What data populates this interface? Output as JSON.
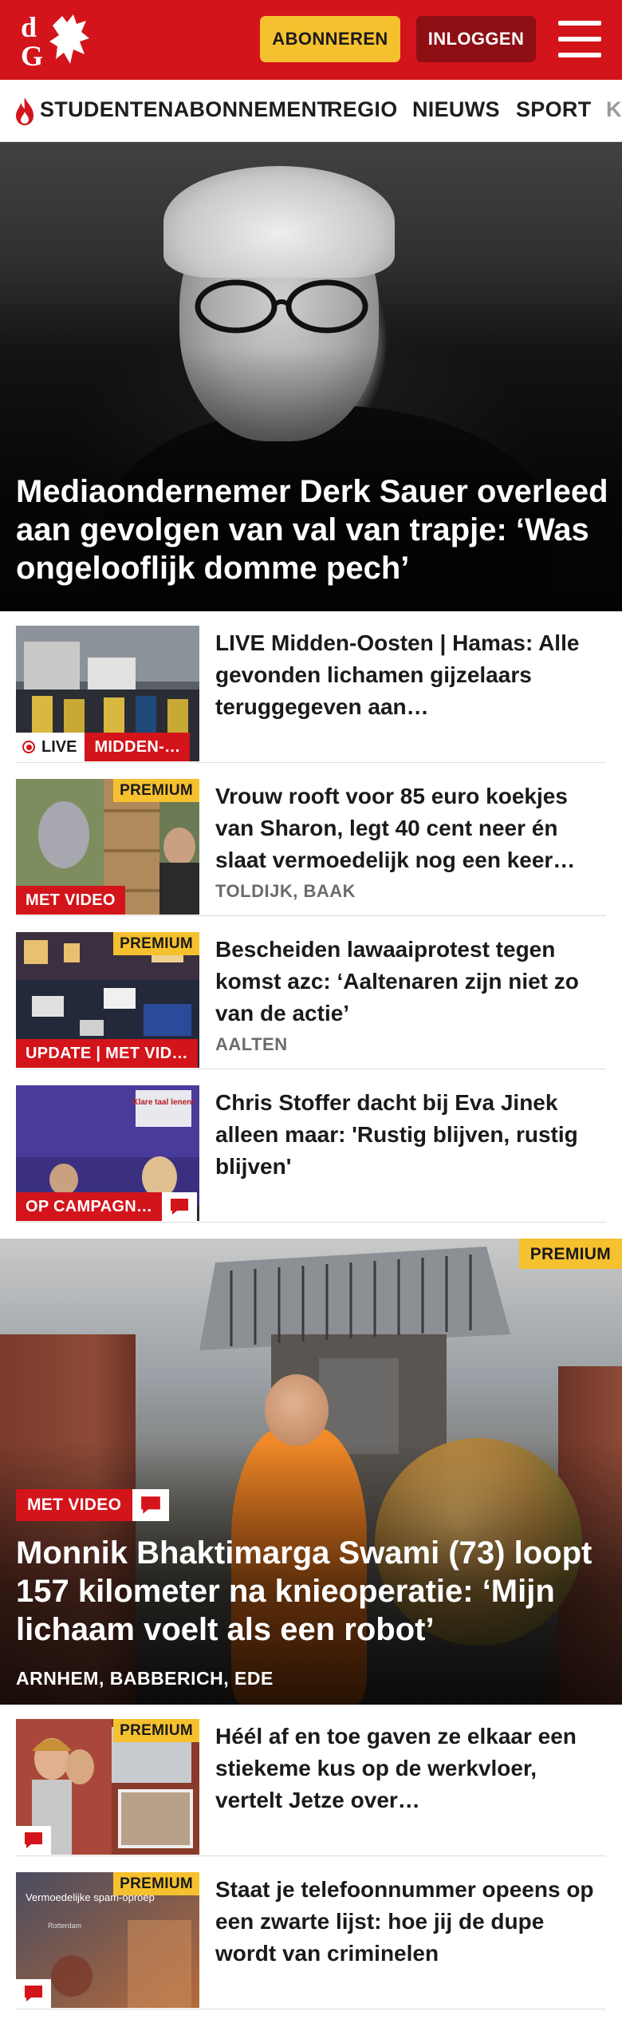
{
  "header": {
    "subscribe_label": "ABONNEREN",
    "login_label": "INLOGGEN",
    "brand_color": "#d3141b",
    "accent_color": "#f6c12f"
  },
  "nav": {
    "items": [
      {
        "label": "STUDENTENABONNEMENT",
        "icon": "flame-icon"
      },
      {
        "label": "REGIO"
      },
      {
        "label": "NIEUWS"
      },
      {
        "label": "SPORT"
      },
      {
        "label": "K"
      }
    ]
  },
  "hero": {
    "title": "Mediaondernemer Derk Sauer overleed aan gevolgen van val van trapje: ‘Was ongelooflijk domme pech’"
  },
  "articles": [
    {
      "title": "LIVE Midden-Oosten | Hamas: Alle gevonden lichamen gijzelaars teruggegeven aan…",
      "live_label": "LIVE",
      "tag": "MIDDEN-…",
      "premium": ""
    },
    {
      "title": "Vrouw rooft voor 85 euro koekjes van Sharon, legt 40 cent neer én slaat vermoedelijk nog een keer…",
      "tag": "MET VIDEO",
      "premium": "PREMIUM",
      "location": "TOLDIJK, BAAK"
    },
    {
      "title": "Bescheiden lawaaiprotest tegen komst azc: ‘Aaltenaren zijn niet zo van de actie’",
      "tag": "UPDATE | MET VID…",
      "premium": "PREMIUM",
      "location": "AALTEN"
    },
    {
      "title": "Chris Stoffer dacht bij Eva Jinek alleen maar: 'Rustig blijven, rustig blijven'",
      "tag": "OP CAMPAGN…",
      "premium": "",
      "thumb_sign": "Klare taal lenen!"
    }
  ],
  "feature": {
    "premium": "PREMIUM",
    "tag": "MET VIDEO",
    "title": "Monnik Bhaktimarga Swami (73) loopt 157 kilometer na knieoperatie: ‘Mijn lichaam voelt als een robot’",
    "location": "ARNHEM, BABBERICH, EDE"
  },
  "articles2": [
    {
      "title": "Héél af en toe gaven ze elkaar een stiekeme kus op de werkvloer, vertelt Jetze over…",
      "premium": "PREMIUM"
    },
    {
      "title": "Staat je telefoonnummer opeens op een zwarte lijst: hoe jij de dupe wordt van criminelen",
      "premium": "PREMIUM",
      "thumb_text": "Vermoedelijke spam-oproep",
      "thumb_subtext": "Rotterdam"
    }
  ]
}
